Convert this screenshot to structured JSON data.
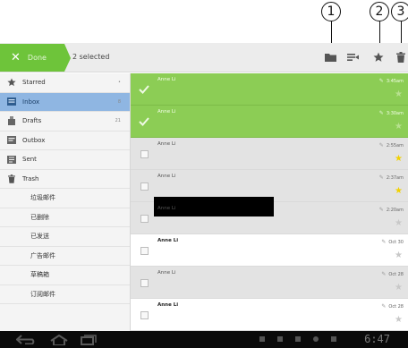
{
  "callouts": [
    "1",
    "2",
    "3"
  ],
  "action_bar": {
    "done_label": "Done",
    "selected_text": "2 selected",
    "accent_color": "#6ec43a",
    "icons": [
      "folder-icon",
      "label-icon",
      "star-icon",
      "trash-icon"
    ]
  },
  "sidebar": {
    "items": [
      {
        "label": "Starred",
        "count": "•",
        "icon": "star-icon"
      },
      {
        "label": "Inbox",
        "count": "8",
        "icon": "inbox-icon",
        "active": true
      },
      {
        "label": "Drafts",
        "count": "21",
        "icon": "drafts-icon"
      },
      {
        "label": "Outbox",
        "count": "",
        "icon": "outbox-icon"
      },
      {
        "label": "Sent",
        "count": "",
        "icon": "sent-icon"
      },
      {
        "label": "Trash",
        "count": "",
        "icon": "trash-icon"
      }
    ],
    "folders": [
      "垃圾邮件",
      "已删除",
      "已发送",
      "广告邮件",
      "草稿箱",
      "订阅邮件"
    ]
  },
  "messages": [
    {
      "sender": "Anne Li",
      "time": "3:45am",
      "state": "selected",
      "starred": false
    },
    {
      "sender": "Anne Li",
      "time": "3:30am",
      "state": "selected",
      "starred": false
    },
    {
      "sender": "Anne Li",
      "time": "2:55am",
      "state": "read",
      "starred": true
    },
    {
      "sender": "Anne Li",
      "time": "2:37am",
      "state": "read",
      "starred": true
    },
    {
      "sender": "Anne Li",
      "time": "2:20am",
      "state": "read",
      "starred": false
    },
    {
      "sender": "Anne Li",
      "time": "Oct 30",
      "state": "unread",
      "starred": false
    },
    {
      "sender": "Anne Li",
      "time": "Oct 28",
      "state": "read",
      "starred": false
    },
    {
      "sender": "Anne Li",
      "time": "Oct 28",
      "state": "unread",
      "starred": false
    }
  ],
  "system_bar": {
    "clock": "6:47",
    "nav_icons": [
      "back-icon",
      "home-icon",
      "recent-apps-icon"
    ]
  }
}
